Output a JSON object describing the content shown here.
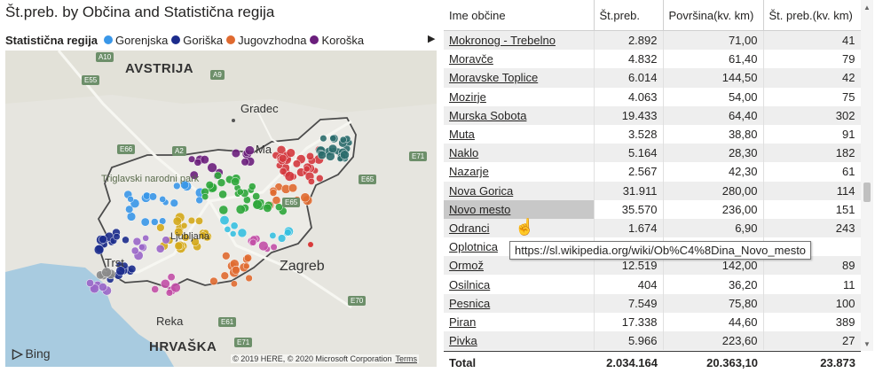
{
  "map": {
    "title": "Št.preb. by Občina and Statistična regija",
    "legend_title": "Statistična regija",
    "legend_items": [
      {
        "label": "Gorenjska",
        "color": "#3a97e8"
      },
      {
        "label": "Goriška",
        "color": "#1c2c8c"
      },
      {
        "label": "Jugovzhodna",
        "color": "#e06a30"
      },
      {
        "label": "Koroška",
        "color": "#6b1f7c"
      }
    ],
    "legend_next_icon": "triangle-right-icon",
    "region_colors": {
      "Gorenjska": "#3a97e8",
      "Goriška": "#1c2c8c",
      "Jugovzhodna": "#e06a30",
      "Koroška": "#6b1f7c",
      "Primorsko-notranjska": "#9a66c8",
      "Osrednjeslovenska": "#d4a919",
      "Savinjska": "#2ea63a",
      "Pomurska": "#2a6b6b",
      "Podravska": "#d4383e",
      "Posavska": "#c24fa6",
      "Zasavska": "#37c0e0",
      "Obalno-kraška": "#8a8a8a"
    },
    "places": {
      "austria": "AVSTRIJA",
      "croatia": "HRVAŠKA",
      "graz": "Gradec",
      "zagreb": "Zagreb",
      "rijeka": "Reka",
      "maribor": "Ma",
      "trieste": "Trst",
      "ljubljana": "Ljubljana",
      "park": "Triglavski narodni park"
    },
    "road_labels": [
      "A10",
      "E55",
      "A9",
      "E66",
      "A2",
      "E71",
      "E65",
      "E61",
      "E70",
      "E71",
      "E65"
    ],
    "bing_label": "Bing",
    "copyright": "© 2019 HERE, © 2020 Microsoft Corporation",
    "terms": "Terms"
  },
  "table": {
    "columns": [
      "Ime občine",
      "Št.preb.",
      "Površina(kv. km)",
      "Št. preb.(kv. km)"
    ],
    "rows": [
      {
        "name": "Mokronog - Trebelno",
        "preb": "2.892",
        "povrsina": "71,00",
        "gostota": "41"
      },
      {
        "name": "Moravče",
        "preb": "4.832",
        "povrsina": "61,40",
        "gostota": "79"
      },
      {
        "name": "Moravske Toplice",
        "preb": "6.014",
        "povrsina": "144,50",
        "gostota": "42"
      },
      {
        "name": "Mozirje",
        "preb": "4.063",
        "povrsina": "54,00",
        "gostota": "75"
      },
      {
        "name": "Murska Sobota",
        "preb": "19.433",
        "povrsina": "64,40",
        "gostota": "302"
      },
      {
        "name": "Muta",
        "preb": "3.528",
        "povrsina": "38,80",
        "gostota": "91"
      },
      {
        "name": "Naklo",
        "preb": "5.164",
        "povrsina": "28,30",
        "gostota": "182"
      },
      {
        "name": "Nazarje",
        "preb": "2.567",
        "povrsina": "42,30",
        "gostota": "61"
      },
      {
        "name": "Nova Gorica",
        "preb": "31.911",
        "povrsina": "280,00",
        "gostota": "114"
      },
      {
        "name": "Novo mesto",
        "preb": "35.570",
        "povrsina": "236,00",
        "gostota": "151"
      },
      {
        "name": "Odranci",
        "preb": "1.674",
        "povrsina": "6,90",
        "gostota": "243"
      },
      {
        "name": "Oplotnica",
        "preb": "",
        "povrsina": "",
        "gostota": ""
      },
      {
        "name": "Ormož",
        "preb": "12.519",
        "povrsina": "142,00",
        "gostota": "89"
      },
      {
        "name": "Osilnica",
        "preb": "404",
        "povrsina": "36,20",
        "gostota": "11"
      },
      {
        "name": "Pesnica",
        "preb": "7.549",
        "povrsina": "75,80",
        "gostota": "100"
      },
      {
        "name": "Piran",
        "preb": "17.338",
        "povrsina": "44,60",
        "gostota": "389"
      },
      {
        "name": "Pivka",
        "preb": "5.966",
        "povrsina": "223,60",
        "gostota": "27"
      }
    ],
    "total": {
      "label": "Total",
      "preb": "2.034.164",
      "povrsina": "20.363,10",
      "gostota": "23.873"
    },
    "tooltip": "https://sl.wikipedia.org/wiki/Ob%C4%8Dina_Novo_mesto",
    "hovered_row": "Novo mesto",
    "cursor_icon": "hand-pointer-icon"
  }
}
